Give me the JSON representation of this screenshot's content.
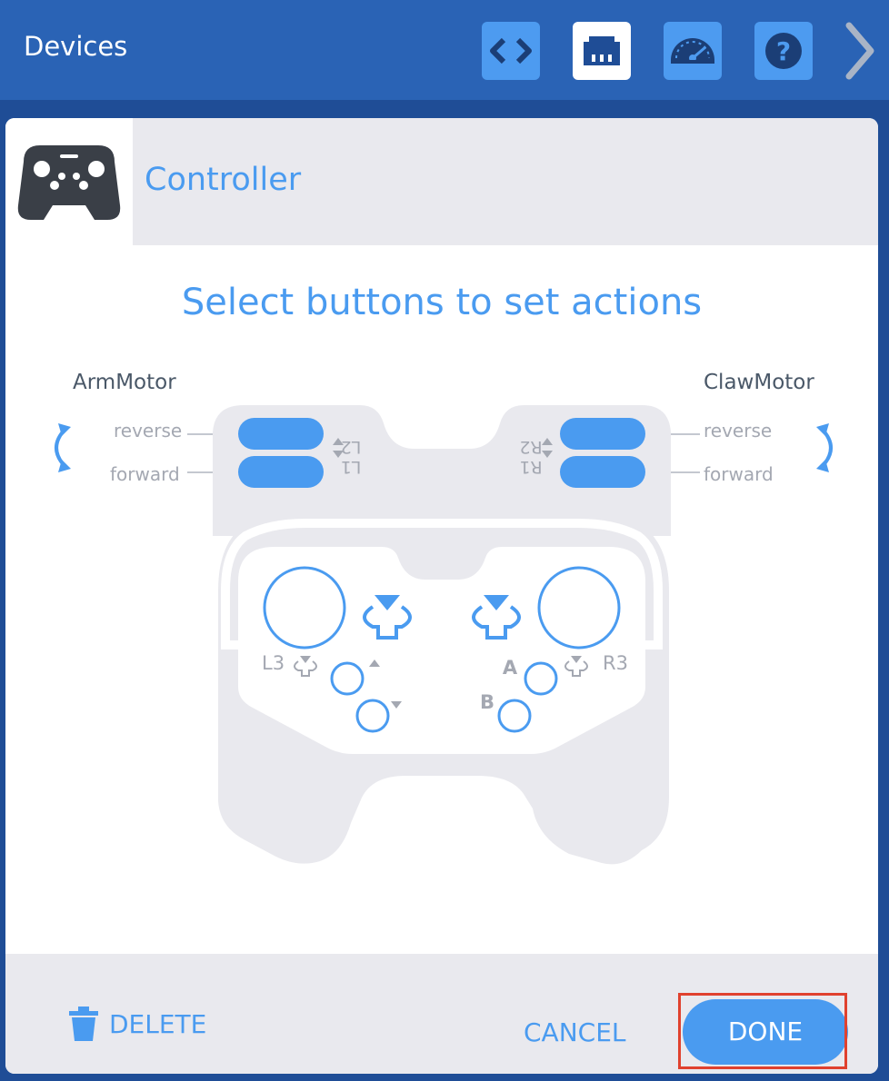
{
  "header": {
    "title": "Devices",
    "buttons": [
      {
        "name": "code-view",
        "icon": "code-brackets-icon"
      },
      {
        "name": "devices",
        "icon": "port-icon",
        "active": true
      },
      {
        "name": "dashboard",
        "icon": "speedometer-icon"
      },
      {
        "name": "help",
        "icon": "help-icon"
      }
    ],
    "next_icon": "chevron-right-icon"
  },
  "device": {
    "name": "Controller",
    "icon": "gamepad-icon"
  },
  "instruction": "Select buttons to set actions",
  "left_motor": {
    "name": "ArmMotor",
    "reverse_label": "reverse",
    "forward_label": "forward"
  },
  "right_motor": {
    "name": "ClawMotor",
    "reverse_label": "reverse",
    "forward_label": "forward"
  },
  "controller_labels": {
    "l2": "L2",
    "l1": "L1",
    "r2": "R2",
    "r1": "R1",
    "l3": "L3",
    "r3": "R3",
    "a": "A",
    "b": "B"
  },
  "footer": {
    "delete_label": "DELETE",
    "cancel_label": "CANCEL",
    "done_label": "DONE"
  },
  "colors": {
    "header_bg": "#2a63b5",
    "accent": "#4a9bf0",
    "controller_body": "#e9e9ee",
    "highlight": "#e0412e"
  }
}
